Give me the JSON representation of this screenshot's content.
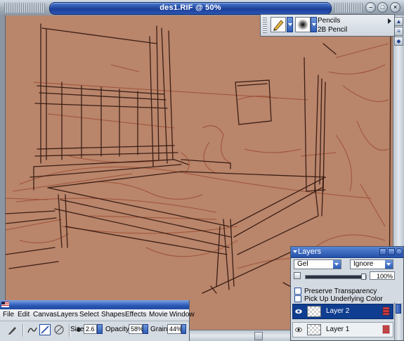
{
  "document": {
    "title": "des1.RIF @ 50%"
  },
  "brush_selector": {
    "category": "Pencils",
    "variant": "2B Pencil",
    "icons": [
      "pencil-icon",
      "dab-circle-icon"
    ]
  },
  "layers_panel": {
    "title": "Layers",
    "composite_method": "Gel",
    "composite_depth": "Ignore",
    "opacity_value": "100%",
    "opacity_fraction": 1.0,
    "preserve_transparency_label": "Preserve Transparency",
    "pick_up_color_label": "Pick Up Underlying Color",
    "layers": [
      {
        "name": "Layer 2",
        "selected": true,
        "visible": true
      },
      {
        "name": "Layer 1",
        "selected": false,
        "visible": true
      }
    ]
  },
  "toolbar": {
    "menu": [
      "File",
      "Edit",
      "Canvas",
      "Layers",
      "Select",
      "Shapes",
      "Effects",
      "Movie",
      "Window"
    ],
    "property_bar": {
      "size_label": "Size:",
      "size_value": "2.6",
      "opacity_label": "Opacity:",
      "opacity_value": "58%",
      "grain_label": "Grain:",
      "grain_value": "44%"
    }
  },
  "colors": {
    "canvas_paper": "#b9856b",
    "sketch_dark": "#3a1e14",
    "sketch_red": "#9a4a30",
    "title_blue": "#1c3f98",
    "selection_blue": "#0f3d8f"
  }
}
